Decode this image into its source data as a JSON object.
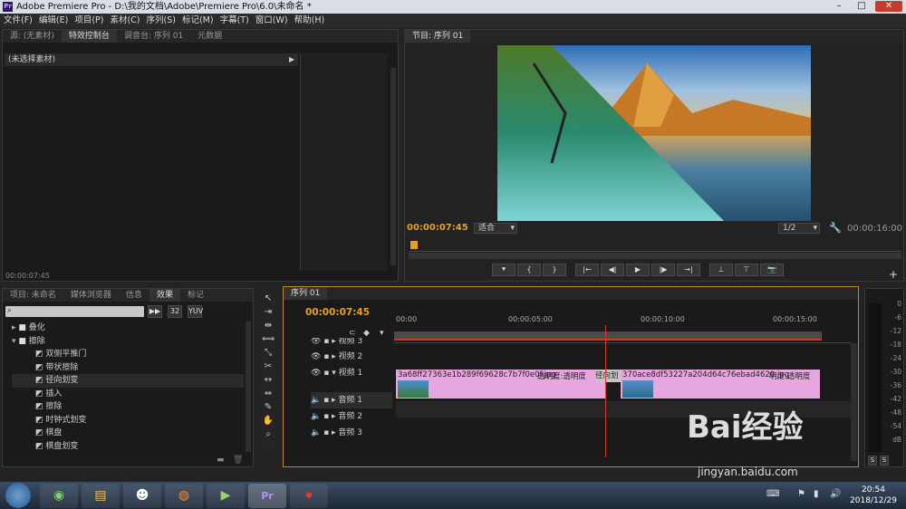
{
  "window": {
    "title": "Adobe Premiere Pro - D:\\我的文档\\Adobe\\Premiere Pro\\6.0\\未命名 *",
    "app_badge": "Pr"
  },
  "menu": [
    "文件(F)",
    "编辑(E)",
    "项目(P)",
    "素材(C)",
    "序列(S)",
    "标记(M)",
    "字幕(T)",
    "窗口(W)",
    "帮助(H)"
  ],
  "source_panel": {
    "tabs": [
      "源: (无素材)",
      "特效控制台",
      "调音台: 序列 01",
      "元数据"
    ],
    "no_clip": "(未选择素材)",
    "timecode": "00:00:07:45"
  },
  "program_monitor": {
    "tab": "节目: 序列 01",
    "timecode": "00:00:07:45",
    "fit": "适合",
    "resolution": "1/2",
    "duration": "00:00:16:00"
  },
  "project_panel": {
    "tabs": [
      "项目: 未命名",
      "媒体浏览器",
      "信息",
      "效果",
      "标记"
    ],
    "tree": [
      {
        "label": "叠化",
        "type": "folder"
      },
      {
        "label": "擦除",
        "type": "folder"
      },
      {
        "label": "双侧平推门",
        "type": "effect"
      },
      {
        "label": "带状擦除",
        "type": "effect"
      },
      {
        "label": "径向划变",
        "type": "effect"
      },
      {
        "label": "插入",
        "type": "effect"
      },
      {
        "label": "擦除",
        "type": "effect"
      },
      {
        "label": "时钟式划变",
        "type": "effect"
      },
      {
        "label": "棋盘",
        "type": "effect"
      },
      {
        "label": "棋盘划变",
        "type": "effect"
      }
    ]
  },
  "timeline": {
    "tab": "序列 01",
    "timecode": "00:00:07:45",
    "ruler": [
      "00:00",
      "00:00:05:00",
      "00:00:10:00",
      "00:00:15:00"
    ],
    "tracks": [
      "视频 3",
      "视频 2",
      "视频 1",
      "音频 1",
      "音频 2",
      "音频 3"
    ],
    "clip1": {
      "name": "3a68ff27363e1b289f69628c7b7f0e0f.jpg",
      "opacity": "透明度:透明度"
    },
    "transition": "径向划",
    "clip2": {
      "name": "370ace8df53227a204d64c76ebad4620.jpg",
      "opacity": "明度:透明度"
    },
    "playhead_fraction": 0.49
  },
  "meter": {
    "labels": [
      "0",
      "-6",
      "-12",
      "-18",
      "-24",
      "-30",
      "-36",
      "-42",
      "-48",
      "-54",
      "dB"
    ],
    "solo": "S"
  },
  "taskbar": {
    "time": "20:54",
    "date": "2018/12/29"
  },
  "watermark": {
    "text": "Bai经验",
    "url": "jingyan.baidu.com"
  }
}
